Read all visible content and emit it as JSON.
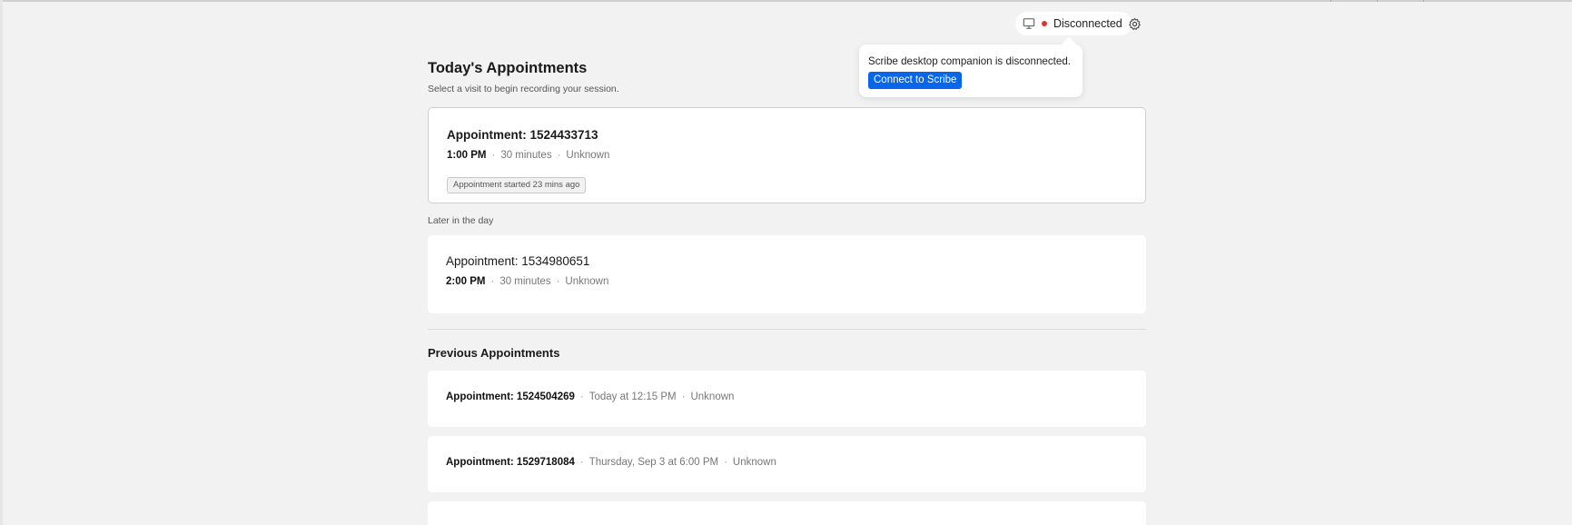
{
  "status": {
    "monitor_icon": "monitor-icon",
    "dot_color": "#e0322e",
    "label": "Disconnected",
    "settings_icon": "gear-icon"
  },
  "popover": {
    "message": "Scribe desktop companion is disconnected.",
    "connect_label": "Connect to Scribe",
    "button_color": "#0a66e8"
  },
  "today": {
    "title": "Today's Appointments",
    "subtitle": "Select a visit to begin recording your session.",
    "current": {
      "title": "Appointment: 1524433713",
      "time": "1:00 PM",
      "duration": "30 minutes",
      "type": "Unknown",
      "badge": "Appointment started 23 mins ago"
    },
    "later_label": "Later in the day",
    "later": [
      {
        "title": "Appointment: 1534980651",
        "time": "2:00 PM",
        "duration": "30 minutes",
        "type": "Unknown"
      }
    ]
  },
  "previous": {
    "title": "Previous Appointments",
    "items": [
      {
        "id": "Appointment: 1524504269",
        "when": "Today at 12:15 PM",
        "type": "Unknown"
      },
      {
        "id": "Appointment: 1529718084",
        "when": "Thursday, Sep 3 at 6:00 PM",
        "type": "Unknown"
      }
    ]
  }
}
